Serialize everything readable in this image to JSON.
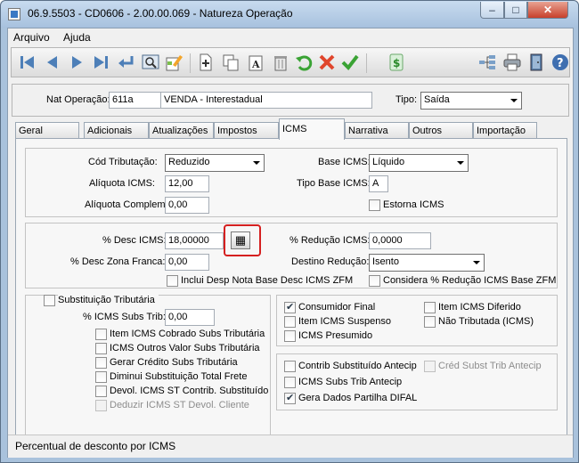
{
  "window": {
    "title": "06.9.5503 - CD0606 - 2.00.00.069 - Natureza Operação",
    "buttons": {
      "minimize": "–",
      "maximize": "□",
      "close": "✕"
    }
  },
  "menu": {
    "items": [
      "Arquivo",
      "Ajuda"
    ]
  },
  "toolbar": {
    "icons": [
      "first-record-icon",
      "previous-record-icon",
      "next-record-icon",
      "last-record-icon",
      "enter-icon",
      "zoom-icon",
      "edit-icon",
      "new-document-icon",
      "copy-icon",
      "text-format-icon",
      "trash-icon",
      "undo-icon",
      "cancel-icon",
      "confirm-icon",
      "dollar-icon",
      "hierarchy-icon",
      "printer-icon",
      "exit-door-icon",
      "help-icon"
    ]
  },
  "header": {
    "nat_operacao_label": "Nat Operação:",
    "nat_operacao_code": "611a",
    "nat_operacao_desc": "VENDA - Interestadual",
    "tipo_label": "Tipo:",
    "tipo_value": "Saída"
  },
  "tabs": [
    "Geral",
    "Adicionais",
    "Atualizações",
    "Impostos",
    "ICMS",
    "Narrativa",
    "Outros",
    "Importação"
  ],
  "active_tab": "ICMS",
  "icms": {
    "cod_tributacao_label": "Cód Tributação:",
    "cod_tributacao_value": "Reduzido",
    "aliquota_icms_label": "Alíquota ICMS:",
    "aliquota_icms_value": "12,00",
    "aliquota_complem_label": "Alíquota Complem:",
    "aliquota_complem_value": "0,00",
    "base_icms_label": "Base ICMS:",
    "base_icms_value": "Líquido",
    "tipo_base_icms_label": "Tipo Base ICMS:",
    "tipo_base_icms_value": "A",
    "estorna_icms_label": "Estorna ICMS",
    "desc_icms_label": "% Desc ICMS:",
    "desc_icms_value": "18,00000",
    "desc_zona_franca_label": "% Desc Zona Franca:",
    "desc_zona_franca_value": "0,00",
    "reducao_icms_label": "% Redução ICMS:",
    "reducao_icms_value": "0,0000",
    "destino_reducao_label": "Destino Redução:",
    "destino_reducao_value": "Isento",
    "inclui_desp_label": "Inclui Desp Nota Base Desc ICMS ZFM",
    "considera_reducao_label": "Considera % Redução ICMS Base ZFM",
    "subst_trib_label": "Substituição Tributária",
    "icms_subs_trib_label": "% ICMS Subs Trib:",
    "icms_subs_trib_value": "0,00",
    "subst_options": [
      {
        "label": "Item ICMS Cobrado Subs Tributária",
        "checked": false,
        "disabled": false
      },
      {
        "label": "ICMS Outros Valor Subs Tributária",
        "checked": false,
        "disabled": false
      },
      {
        "label": "Gerar Crédito Subs Tributária",
        "checked": false,
        "disabled": false
      },
      {
        "label": "Diminui Substituição Total Frete",
        "checked": false,
        "disabled": false
      },
      {
        "label": "Devol. ICMS ST Contrib. Substituído",
        "checked": false,
        "disabled": false
      },
      {
        "label": "Deduzir ICMS ST Devol. Cliente",
        "checked": false,
        "disabled": true
      }
    ],
    "right_options_1": [
      {
        "label": "Consumidor Final",
        "checked": true
      },
      {
        "label": "Item ICMS Suspenso",
        "checked": false
      },
      {
        "label": "ICMS Presumido",
        "checked": false
      }
    ],
    "right_options_2": [
      {
        "label": "Item ICMS Diferido",
        "checked": false
      },
      {
        "label": "Não Tributada (ICMS)",
        "checked": false
      }
    ],
    "right_options_3": [
      {
        "label": "Contrib Substituído Antecip",
        "checked": false,
        "disabled": false
      },
      {
        "label": "ICMS Subs Trib Antecip",
        "checked": false,
        "disabled": false
      },
      {
        "label": "Gera Dados Partilha DIFAL",
        "checked": true,
        "disabled": false
      }
    ],
    "cred_subst_label": "Créd Subst Trib Antecip"
  },
  "status": {
    "text": "Percentual de desconto por ICMS"
  }
}
